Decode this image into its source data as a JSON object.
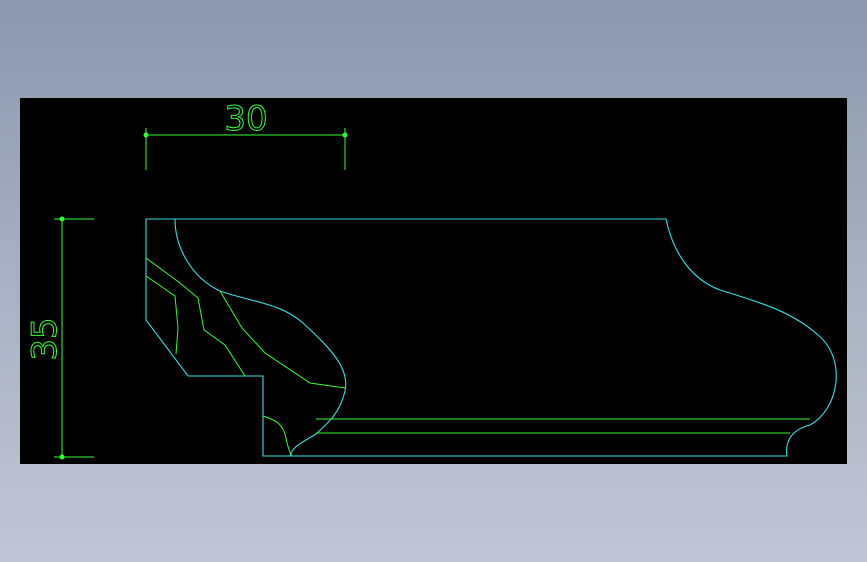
{
  "colors": {
    "background_top": "#8a98ad",
    "background_bottom": "#c0c6d3",
    "canvas": "#000000",
    "dimension": "#33ff33",
    "outline": "#33e0e0",
    "detail": "#33ff33"
  },
  "dimensions": {
    "horizontal": {
      "value": "30"
    },
    "vertical": {
      "value": "35"
    }
  }
}
